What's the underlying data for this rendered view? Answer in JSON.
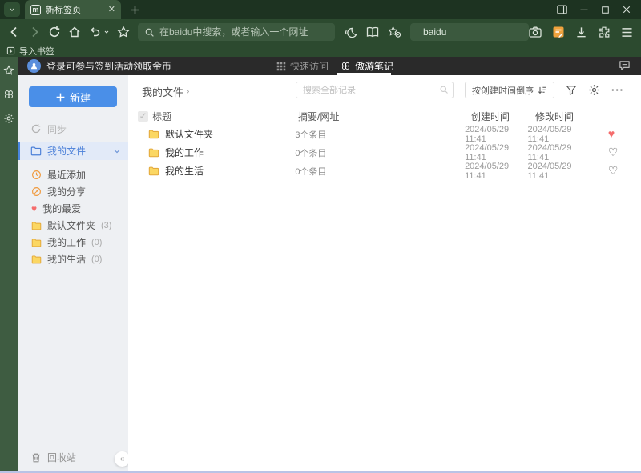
{
  "browser": {
    "tab_title": "新标签页",
    "address_placeholder": "在baidu中搜索，或者输入一个网址",
    "search_engine_value": "baidu",
    "bookmarks_import_label": "导入书签"
  },
  "app_header": {
    "login_text": "登录可参与签到活动领取金币",
    "tab_quick_access": "快速访问",
    "tab_notes": "傲游笔记"
  },
  "sidebar": {
    "new_button_label": "新建",
    "sync_label": "同步",
    "my_files_label": "我的文件",
    "items": [
      {
        "label": "最近添加",
        "count": "",
        "icon": "clock"
      },
      {
        "label": "我的分享",
        "count": "",
        "icon": "share"
      },
      {
        "label": "我的最爱",
        "count": "",
        "icon": "heart"
      },
      {
        "label": "默认文件夹",
        "count": "(3)",
        "icon": "folder"
      },
      {
        "label": "我的工作",
        "count": "(0)",
        "icon": "folder"
      },
      {
        "label": "我的生活",
        "count": "(0)",
        "icon": "folder"
      }
    ],
    "trash_label": "回收站"
  },
  "content": {
    "breadcrumb": "我的文件",
    "search_placeholder": "搜索全部记录",
    "sort_button_label": "按创建时间倒序",
    "table": {
      "headers": {
        "title": "标题",
        "summary": "摘要/网址",
        "created": "创建时间",
        "modified": "修改时间"
      },
      "rows": [
        {
          "title": "默认文件夹",
          "summary": "3个条目",
          "created": "2024/05/29 11:41",
          "modified": "2024/05/29 11:41",
          "favorite": true
        },
        {
          "title": "我的工作",
          "summary": "0个条目",
          "created": "2024/05/29 11:41",
          "modified": "2024/05/29 11:41",
          "favorite": false
        },
        {
          "title": "我的生活",
          "summary": "0个条目",
          "created": "2024/05/29 11:41",
          "modified": "2024/05/29 11:41",
          "favorite": false
        }
      ]
    }
  },
  "glyphs": {
    "tab_logo": "m",
    "tab_close": "✕",
    "plus": "+",
    "breadcrumb_arrow": "›",
    "chevron_down": "⌄",
    "collapse": "«",
    "more": "···",
    "check": "✓",
    "heart_filled": "♥",
    "heart_outline": "♡"
  },
  "colors": {
    "chrome_green_dark": "#1d3321",
    "chrome_green": "#2c4a2f",
    "tab_green": "#3c5a3e",
    "strip_green": "#3e5c41",
    "header_dark": "#2a2a2a",
    "accent_blue": "#4a8fe8",
    "selected_blue_bg": "#e2eaf8",
    "folder_yellow": "#e3a93c",
    "icon_orange": "#f09a3e",
    "favorite_red": "#f56c6c",
    "sidebar_bg": "#eef0f3"
  }
}
